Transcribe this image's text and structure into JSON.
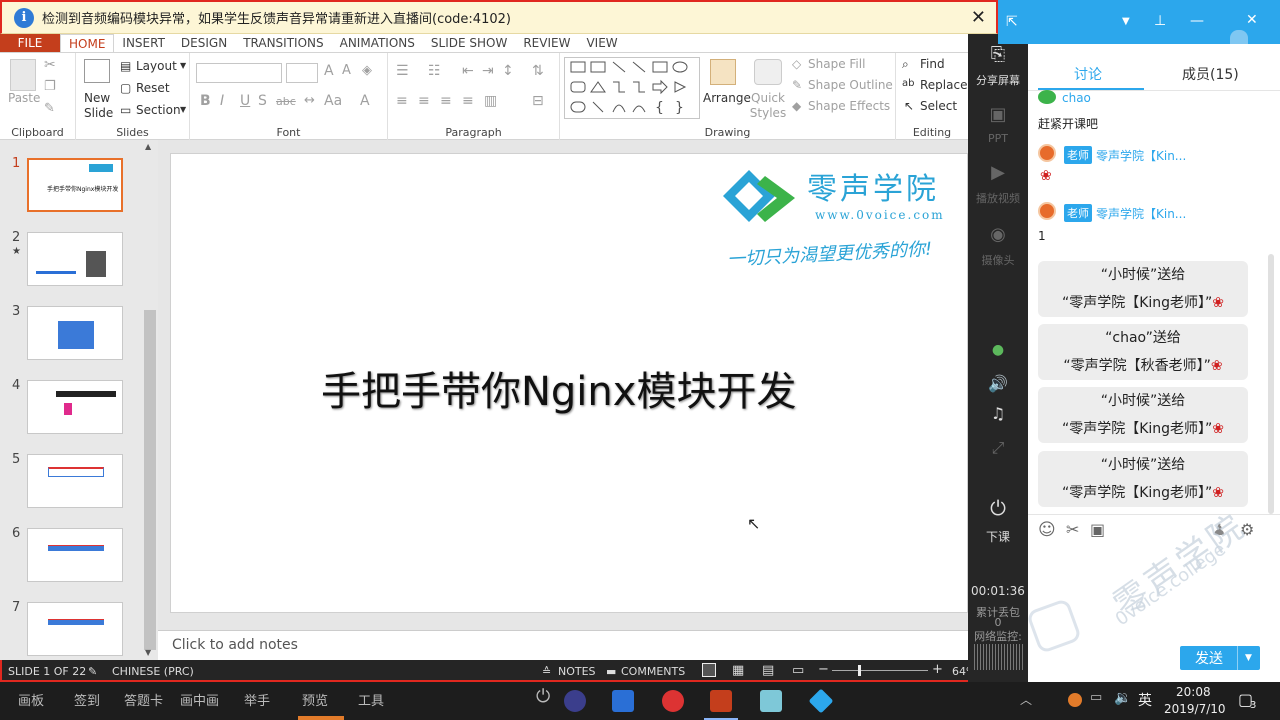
{
  "notice": {
    "text": "检测到音频编码模块异常，如果学生反馈声音异常请重新进入直播间(code:4102)",
    "close": "✕"
  },
  "ribbon": {
    "file": "FILE",
    "tabs": [
      "HOME",
      "INSERT",
      "DESIGN",
      "TRANSITIONS",
      "ANIMATIONS",
      "SLIDE SHOW",
      "REVIEW",
      "VIEW"
    ],
    "clipboard": {
      "paste": "Paste",
      "label": "Clipboard"
    },
    "slides": {
      "new_slide": "New Slide",
      "layout": "Layout",
      "reset": "Reset",
      "section": "Section",
      "label": "Slides"
    },
    "font": {
      "label": "Font"
    },
    "paragraph": {
      "label": "Paragraph"
    },
    "drawing": {
      "arrange": "Arrange",
      "quick_styles": "Quick Styles",
      "shape_fill": "Shape Fill",
      "shape_outline": "Shape Outline",
      "shape_effects": "Shape Effects",
      "label": "Drawing"
    },
    "editing": {
      "find": "Find",
      "replace": "Replace",
      "select": "Select",
      "label": "Editing"
    }
  },
  "thumbs": [
    "1",
    "2",
    "3",
    "4",
    "5",
    "6",
    "7"
  ],
  "slide": {
    "title": "手把手带你Nginx模块开发",
    "logo_name": "零声学院",
    "logo_url": "www.0voice.com",
    "slogan": "一切只为渴望更优秀的你!",
    "thumb1_text": "手把手带你Nginx模块开发"
  },
  "notes_placeholder": "Click to add notes",
  "status": {
    "slide": "SLIDE 1 OF 22",
    "lang": "CHINESE (PRC)",
    "notes": "NOTES",
    "comments": "COMMENTS",
    "zoom": "64%"
  },
  "tools": {
    "share": "分享屏幕",
    "ppt": "PPT",
    "video": "播放视频",
    "camera": "摄像头",
    "end": "下课",
    "timer": "00:01:36",
    "loss_label": "累计丢包",
    "loss_value": "0",
    "net": "网络监控:"
  },
  "chat": {
    "tab_discuss": "讨论",
    "tab_members": "成员(15)",
    "msg1_user": "chao",
    "msg1_text": "赶紧开课吧",
    "teacher_badge": "老师",
    "teacher_name": "零声学院【Kin...",
    "msg3_text": "1",
    "gifts": [
      {
        "line1": "“小时候”送给",
        "line2": "“零声学院【King老师】”"
      },
      {
        "line1": "“chao”送给",
        "line2": "“零声学院【秋香老师】”"
      },
      {
        "line1": "“小时候”送给",
        "line2": "“零声学院【King老师】”"
      },
      {
        "line1": "“小时候”送给",
        "line2": "“零声学院【King老师】”"
      }
    ],
    "send": "发送",
    "watermark": "零声学院",
    "watermark2": "0voice.college"
  },
  "taskbar": {
    "items": [
      "画板",
      "签到",
      "答题卡",
      "画中画",
      "举手",
      "预览",
      "工具"
    ],
    "ime": "英",
    "time": "20:08",
    "date": "2019/7/10",
    "notif": "3"
  }
}
